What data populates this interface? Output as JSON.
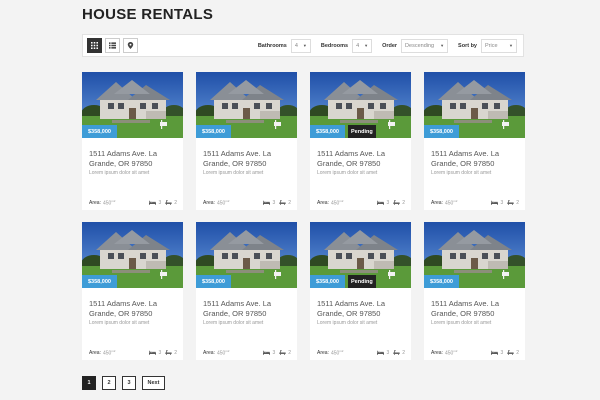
{
  "page": {
    "title": "HOUSE RENTALS"
  },
  "toolbar": {
    "views": [
      {
        "name": "grid-view",
        "icon": "grid-icon",
        "active": true
      },
      {
        "name": "list-view",
        "icon": "list-icon",
        "active": false
      },
      {
        "name": "map-view",
        "icon": "map-pin-icon",
        "active": false
      }
    ],
    "bathrooms": {
      "label": "Bathrooms",
      "value": "4"
    },
    "bedrooms": {
      "label": "Bedrooms",
      "value": "4"
    },
    "order": {
      "label": "Order",
      "value": "Descending"
    },
    "sort": {
      "label": "Sort by",
      "value": "Price"
    }
  },
  "listings": [
    {
      "price": "$358,000",
      "status": "",
      "address": "1511 Adams Ave. La Grande, OR 97850",
      "description": "Lorem ipsum dolor sit amet",
      "area_label": "Area:",
      "area": "450",
      "area_unit": "m2",
      "beds": "3",
      "baths": "2"
    },
    {
      "price": "$358,000",
      "status": "",
      "address": "1511 Adams Ave. La Grande, OR 97850",
      "description": "Lorem ipsum dolor sit amet",
      "area_label": "Area:",
      "area": "450",
      "area_unit": "m2",
      "beds": "3",
      "baths": "2"
    },
    {
      "price": "$358,000",
      "status": "Pending",
      "address": "1511 Adams Ave. La Grande, OR 97850",
      "description": "Lorem ipsum dolor sit amet",
      "area_label": "Area:",
      "area": "450",
      "area_unit": "m2",
      "beds": "3",
      "baths": "2"
    },
    {
      "price": "$358,000",
      "status": "",
      "address": "1511 Adams Ave. La Grande, OR 97850",
      "description": "Lorem ipsum dolor sit amet",
      "area_label": "Area:",
      "area": "450",
      "area_unit": "m2",
      "beds": "3",
      "baths": "2"
    },
    {
      "price": "$358,000",
      "status": "",
      "address": "1511 Adams Ave. La Grande, OR 97850",
      "description": "Lorem ipsum dolor sit amet",
      "area_label": "Area:",
      "area": "450",
      "area_unit": "m2",
      "beds": "3",
      "baths": "2"
    },
    {
      "price": "$358,000",
      "status": "",
      "address": "1511 Adams Ave. La Grande, OR 97850",
      "description": "Lorem ipsum dolor sit amet",
      "area_label": "Area:",
      "area": "450",
      "area_unit": "m2",
      "beds": "3",
      "baths": "2"
    },
    {
      "price": "$358,000",
      "status": "Pending",
      "address": "1511 Adams Ave. La Grande, OR 97850",
      "description": "Lorem ipsum dolor sit amet",
      "area_label": "Area:",
      "area": "450",
      "area_unit": "m2",
      "beds": "3",
      "baths": "2"
    },
    {
      "price": "$358,000",
      "status": "",
      "address": "1511 Adams Ave. La Grande, OR 97850",
      "description": "Lorem ipsum dolor sit amet",
      "area_label": "Area:",
      "area": "450",
      "area_unit": "m2",
      "beds": "3",
      "baths": "2"
    }
  ],
  "pagination": {
    "pages": [
      {
        "label": "1",
        "active": true
      },
      {
        "label": "2",
        "active": false
      },
      {
        "label": "3",
        "active": false
      }
    ],
    "next_label": "Next"
  },
  "colors": {
    "price_badge": "#3e9cd7",
    "status_badge": "#222222",
    "background": "#f3f3f3"
  }
}
